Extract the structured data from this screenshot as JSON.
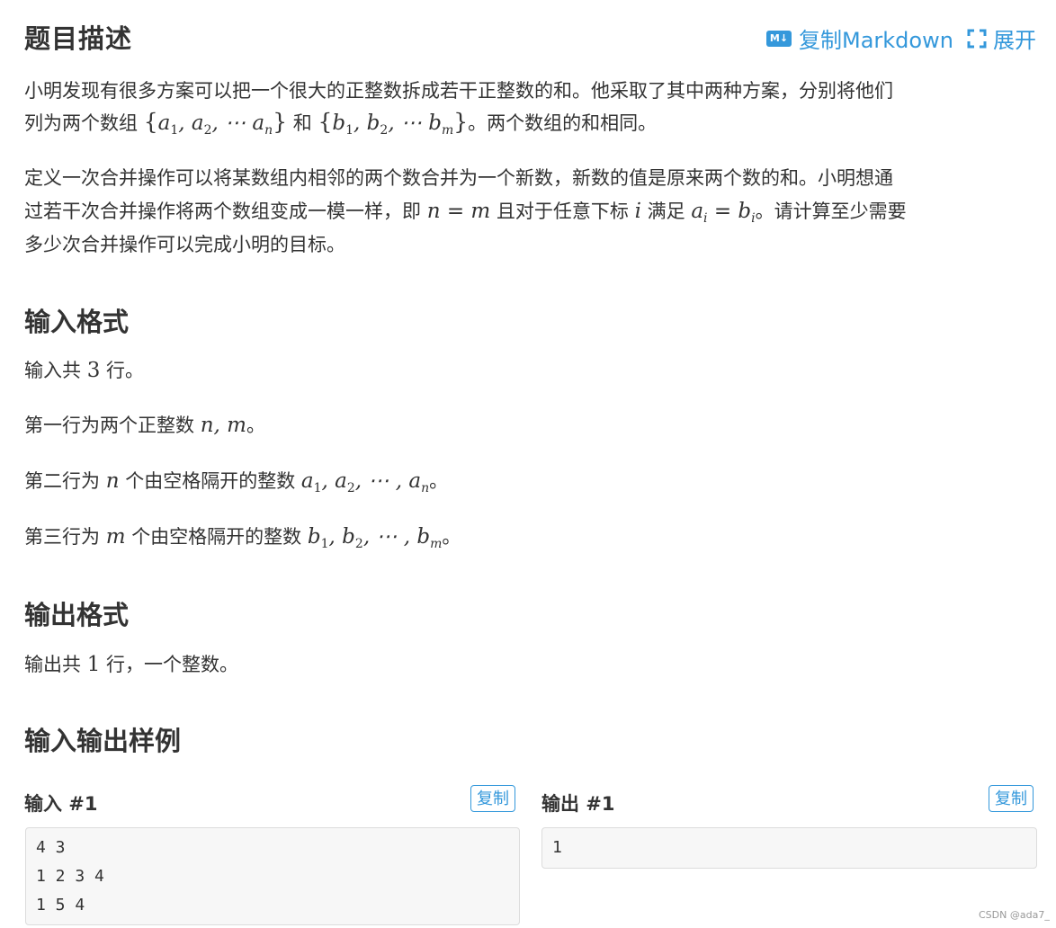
{
  "header": {
    "title": "题目描述",
    "copy_markdown_icon": "M↓",
    "copy_markdown_label": "复制Markdown",
    "expand_label": "展开",
    "expand_icon": "expand-icon"
  },
  "description": {
    "p1_line1": "小明发现有很多方案可以把一个很大的正整数拆成若干正整数的和。他采取了其中两种方案，分别将他们",
    "p1_line2_a": "列为两个数组",
    "p1_line2_and": "和",
    "p1_line2_b": "。两个数组的和相同。",
    "p2_line1": "定义一次合并操作可以将某数组内相邻的两个数合并为一个新数，新数的值是原来两个数的和。小明想通",
    "p2_line2_a": "过若干次合并操作将两个数组变成一模一样，即",
    "p2_line2_b": "且对于任意下标",
    "p2_line2_c": "满足",
    "p2_line2_d": "。请计算至少需要",
    "p2_line3": "多少次合并操作可以完成小明的目标。"
  },
  "input_format": {
    "title": "输入格式",
    "l1_a": "输入共",
    "l1_num": "3",
    "l1_b": "行。",
    "l2_a": "第一行为两个正整数",
    "l2_end": "。",
    "l3_a": "第二行为",
    "l3_b": "个由空格隔开的整数",
    "l3_end": "。",
    "l4_a": "第三行为",
    "l4_b": "个由空格隔开的整数",
    "l4_end": "。"
  },
  "output_format": {
    "title": "输出格式",
    "l1_a": "输出共",
    "l1_num": "1",
    "l1_b": "行，一个整数。"
  },
  "samples": {
    "title": "输入输出样例",
    "input_label": "输入 #1",
    "output_label": "输出 #1",
    "copy_label": "复制",
    "input_lines": [
      "4 3",
      "1 2 3 4",
      "1 5 4"
    ],
    "output_lines": [
      "1"
    ]
  },
  "footer": {
    "watermark": "CSDN @ada7_"
  },
  "colors": {
    "accent": "#3498db",
    "text": "#333333",
    "code_bg": "#f7f7f7",
    "code_border": "#dcdcdc"
  }
}
